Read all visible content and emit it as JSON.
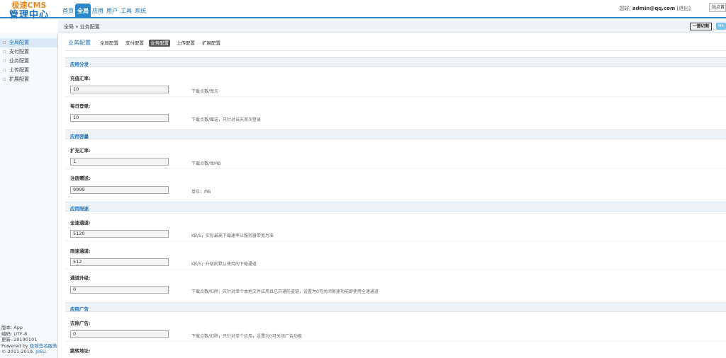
{
  "logo": {
    "line1": "极速CMS",
    "line2": "管理中心"
  },
  "topnav": [
    {
      "label": "首页",
      "active": false
    },
    {
      "label": "全局",
      "active": true
    },
    {
      "label": "应用",
      "active": false
    },
    {
      "label": "用户",
      "active": false
    },
    {
      "label": "工具",
      "active": false
    },
    {
      "label": "系统",
      "active": false
    }
  ],
  "user": {
    "greeting": "您好,",
    "name": "admin@qq.com",
    "logout": "[退出]",
    "site_button": "站点首页"
  },
  "breadcrumb": "全局 » 业务配置",
  "toolbar": {
    "clear_cache": "一键切割",
    "tag": "MA"
  },
  "sidebar": {
    "items": [
      {
        "label": "全局配置",
        "active": true
      },
      {
        "label": "支付配置",
        "active": false
      },
      {
        "label": "业务配置",
        "active": false
      },
      {
        "label": "上传配置",
        "active": false
      },
      {
        "label": "扩展配置",
        "active": false
      }
    ],
    "footer": {
      "version": "版本: App",
      "encoding": "编码: UTF-8",
      "updated": "更新: 20190101",
      "powered_prefix": "Powered by ",
      "powered_link": "极致签名服务",
      "copyright_prefix": "© 2011-2019, ",
      "copyright_link": "JIISU."
    }
  },
  "page": {
    "title": "业务配置",
    "tabs": [
      {
        "label": "全局配置",
        "active": false
      },
      {
        "label": "支付配置",
        "active": false
      },
      {
        "label": "业务配置",
        "active": true
      },
      {
        "label": "上传配置",
        "active": false
      },
      {
        "label": "扩展配置",
        "active": false
      }
    ]
  },
  "sections": {
    "s1": {
      "title": "应用分发"
    },
    "s2": {
      "title": "应用容量"
    },
    "s3": {
      "title": "应用限速"
    },
    "s4": {
      "title": "应用广告"
    }
  },
  "fields": {
    "f1": {
      "label": "充值汇率:",
      "value": "10",
      "hint": "下载点数/每元"
    },
    "f2": {
      "label": "每日登录:",
      "value": "10",
      "hint": "下载点数/赠送，只针对当天首次登录"
    },
    "f3": {
      "label": "扩充汇率:",
      "value": "1",
      "hint": "下载点数/每MB"
    },
    "f4": {
      "label": "注册赠送:",
      "value": "9999",
      "hint": "单位：MB"
    },
    "f5": {
      "label": "全速通道:",
      "value": "5120",
      "hint": "KB/S，实际最高下载速率以服务器带宽为准"
    },
    "f6": {
      "label": "限速通道:",
      "value": "512",
      "hint": "KB/S，升级前默认使用的下载通道"
    },
    "f7": {
      "label": "通道升级:",
      "value": "0",
      "hint": "下载点数/扣除，只针对单个本地文件应用且已开通防盗链，设置为0可关闭限速功能即使用全速通道"
    },
    "f8": {
      "label": "去除广告:",
      "value": "0",
      "hint": "下载点数/扣除，只针对单个应用，设置为0可关闭广告功能"
    },
    "f9": {
      "label": "跳转地址:"
    }
  }
}
